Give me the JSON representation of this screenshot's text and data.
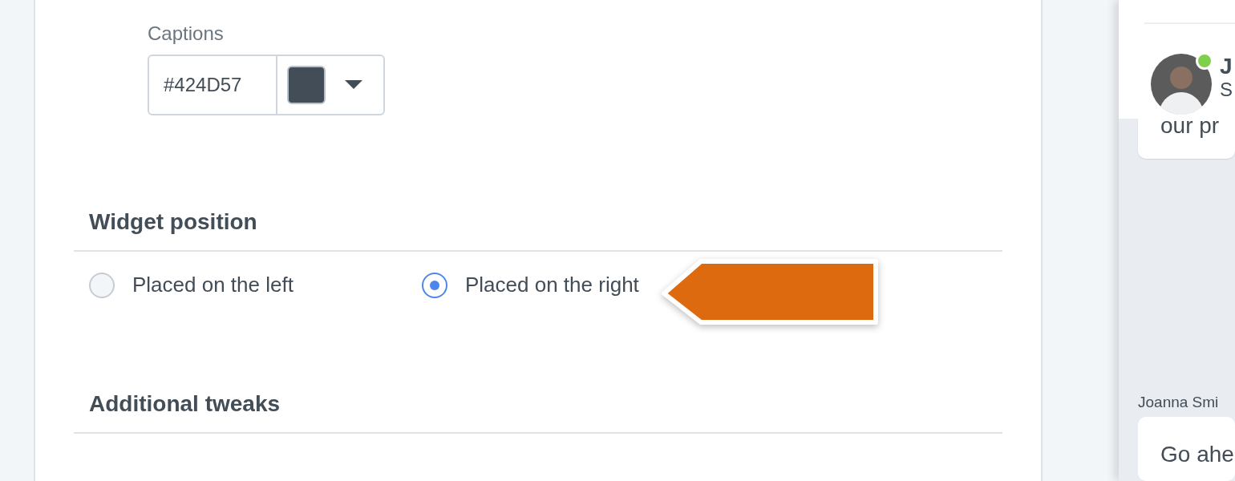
{
  "captions": {
    "label": "Captions",
    "value": "#424D57"
  },
  "widget_position": {
    "title": "Widget position",
    "options": [
      {
        "label": "Placed on the left",
        "selected": false
      },
      {
        "label": "Placed on the right",
        "selected": true
      }
    ]
  },
  "additional_tweaks": {
    "title": "Additional tweaks"
  },
  "chat": {
    "header": {
      "name": "J",
      "subtitle": "S",
      "online": true
    },
    "messages": [
      {
        "text": "our pr"
      },
      {
        "author": "Joanna Smi",
        "text": "Go ahe"
      }
    ]
  }
}
